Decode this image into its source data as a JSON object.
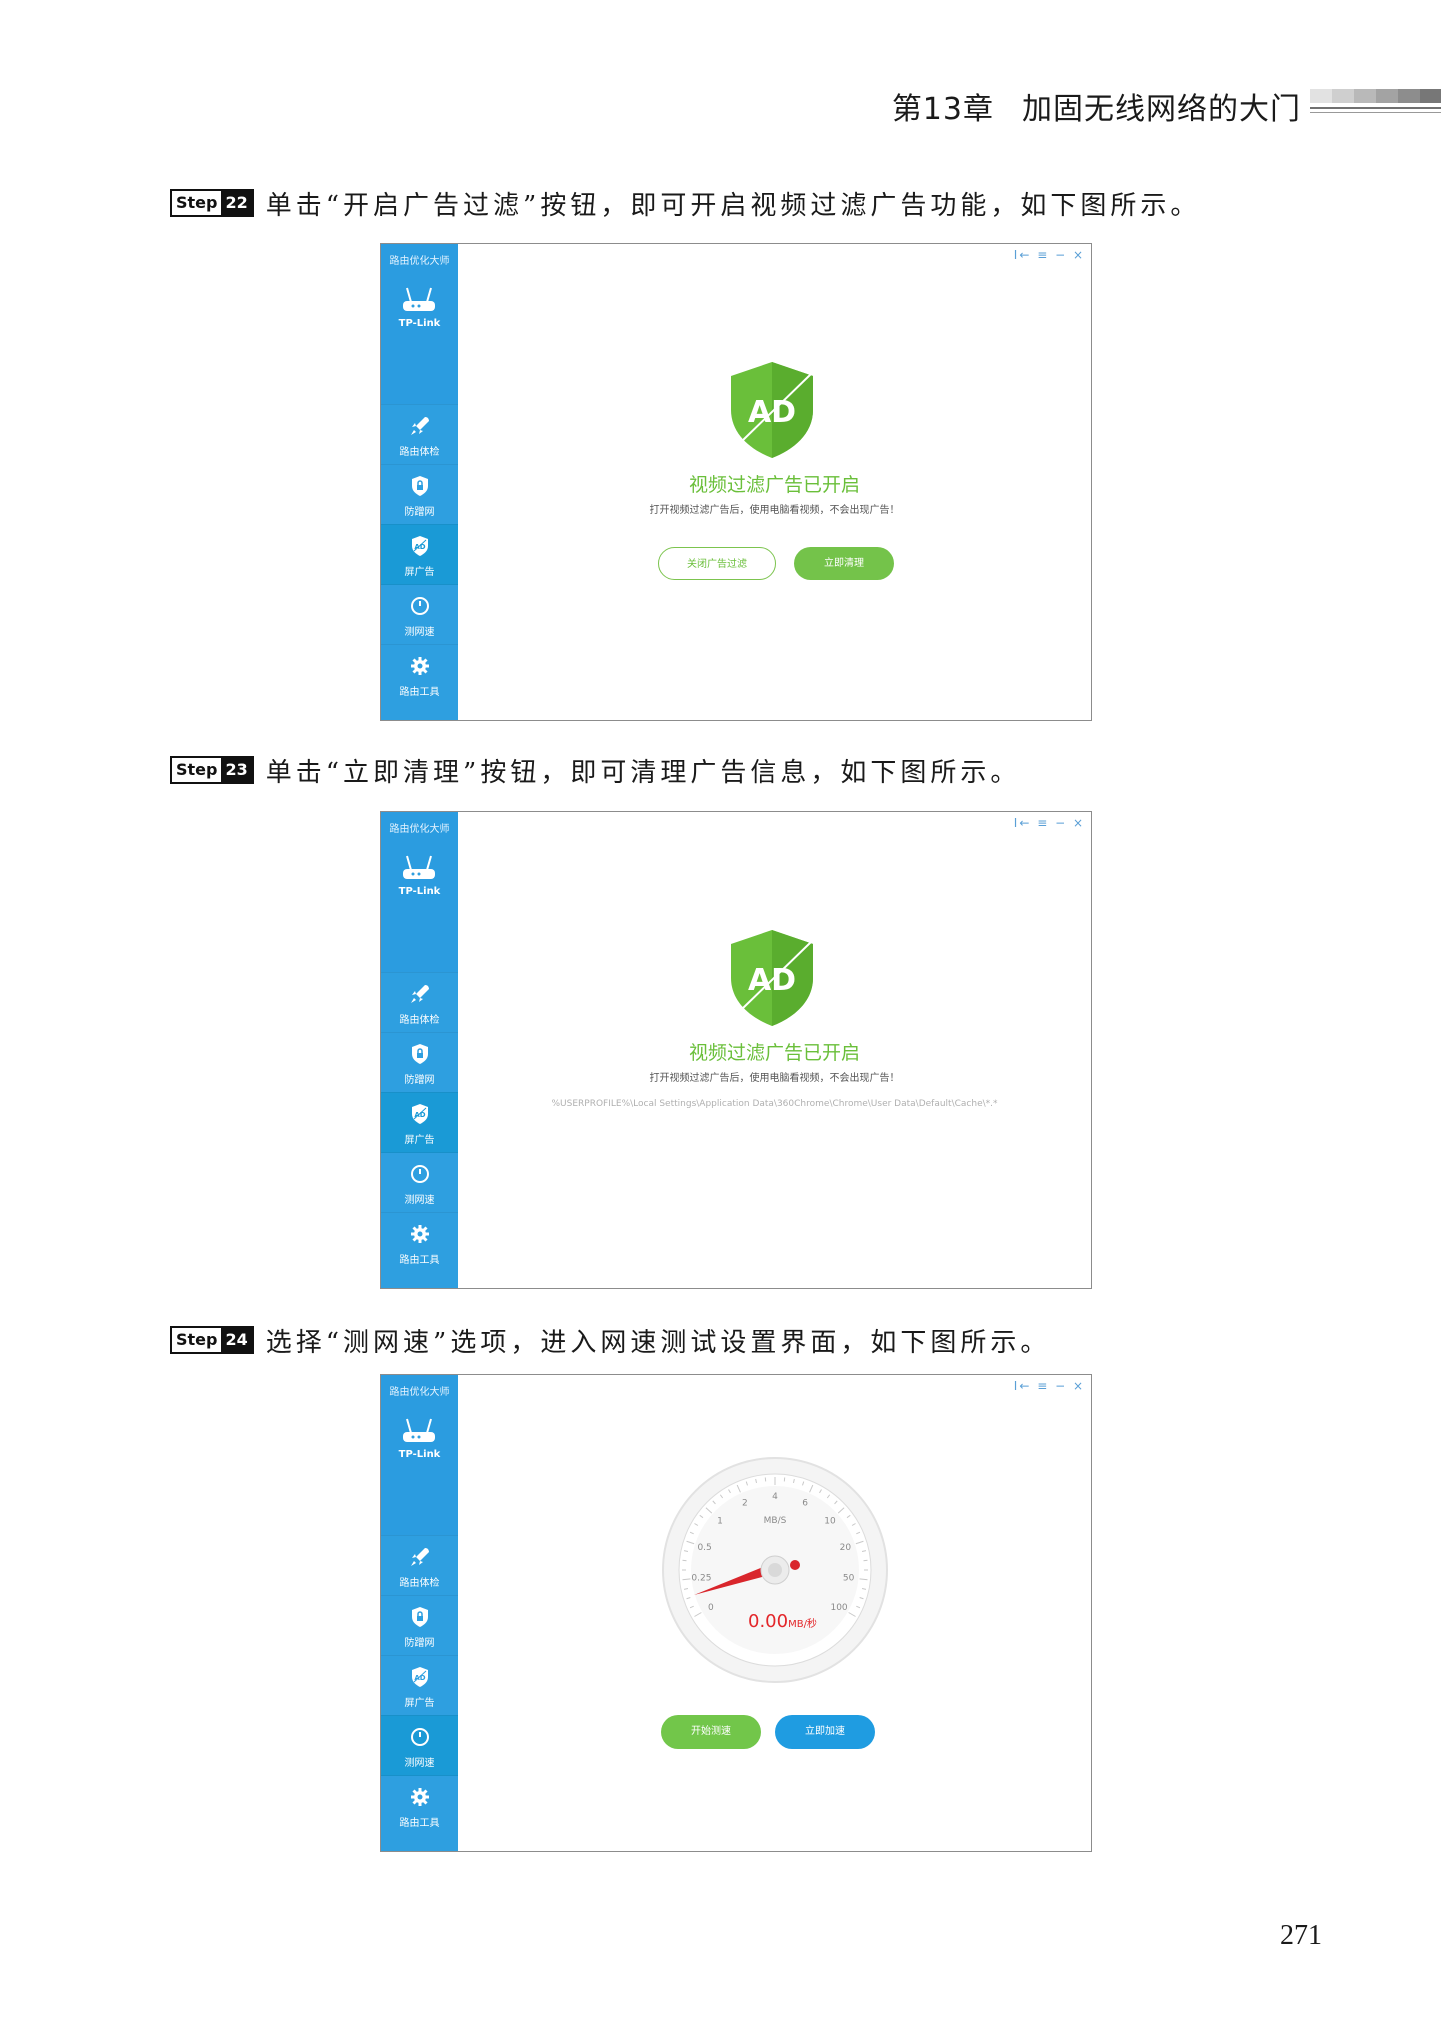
{
  "header": {
    "chapter": "第13章",
    "title": "加固无线网络的大门"
  },
  "steps": [
    {
      "badge_word": "Step",
      "badge_num": "22",
      "text": "单击“开启广告过滤”按钮，即可开启视频过滤广告功能，如下图所示。"
    },
    {
      "badge_word": "Step",
      "badge_num": "23",
      "text": "单击“立即清理”按钮，即可清理广告信息，如下图所示。"
    },
    {
      "badge_word": "Step",
      "badge_num": "24",
      "text": "选择“测网速”选项，进入网速测试设置界面，如下图所示。"
    }
  ],
  "app": {
    "name": "路由优化大师",
    "brand": "TP-Link",
    "window_controls": "I← ≡ − ×",
    "nav": [
      "路由体检",
      "防蹭网",
      "屏广告",
      "测网速",
      "路由工具"
    ],
    "colors": {
      "sidebar": "#2e9fe0",
      "active": "#1a9ad6",
      "green": "#6abf3a",
      "blue": "#1f9ce1",
      "red": "#e3262a"
    }
  },
  "shot1": {
    "shield_text": "AD",
    "title": "视频过滤广告已开启",
    "desc": "打开视频过滤广告后，使用电脑看视频，不会出现广告！",
    "btn_close": "关闭广告过滤",
    "btn_clean": "立即清理",
    "active_nav": 2
  },
  "shot2": {
    "shield_text": "AD",
    "title": "视频过滤广告已开启",
    "desc": "打开视频过滤广告后，使用电脑看视频，不会出现广告！",
    "path": "%USERPROFILE%\\Local Settings\\Application Data\\360Chrome\\Chrome\\User Data\\Default\\Cache\\*.*",
    "active_nav": 2
  },
  "shot3": {
    "unit_label": "MB/S",
    "ticks": [
      "0",
      "0.25",
      "0.5",
      "1",
      "2",
      "4",
      "6",
      "10",
      "20",
      "50",
      "100"
    ],
    "speed_value": "0.00",
    "speed_unit": "MB/秒",
    "btn_start": "开始测速",
    "btn_speedup": "立即加速",
    "active_nav": 3
  },
  "page_number": "271"
}
